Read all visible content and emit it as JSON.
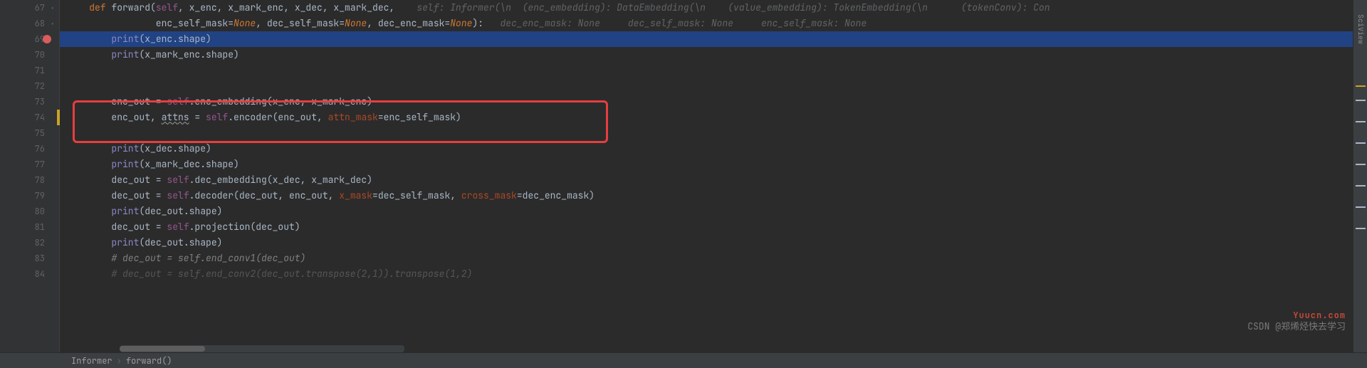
{
  "gutter": {
    "lines": [
      "67",
      "68",
      "69",
      "70",
      "71",
      "72",
      "73",
      "74",
      "75",
      "76",
      "77",
      "78",
      "79",
      "80",
      "81",
      "82",
      "83",
      "84"
    ]
  },
  "code": {
    "l67_def": "def ",
    "l67_name": "forward(",
    "l67_self": "self",
    "l67_rest": ", x_enc, x_mark_enc, x_dec, x_mark_dec,",
    "l67_hint": "    self: Informer(\\n  (enc_embedding): DataEmbedding(\\n    (value_embedding): TokenEmbedding(\\n      (tokenConv): Con",
    "l68_a": "                enc_self_mask=",
    "l68_b": ", dec_self_mask=",
    "l68_c": ", dec_enc_mask=",
    "l68_d": "):",
    "l68_none": "None",
    "l68_hint": "   dec_enc_mask: None     dec_self_mask: None     enc_self_mask: None",
    "l69_print": "print",
    "l69_open": "(x_enc.shape)",
    "l70_print": "print",
    "l70_open": "(x_mark_enc.shape)",
    "l73_a": "enc_out = ",
    "l73_self": "self",
    "l73_b": ".enc_embedding(x_enc, x_mark_enc)",
    "l74_a": "enc_out, ",
    "l74_attns": "attns",
    "l74_b": " = ",
    "l74_self": "self",
    "l74_c": ".encoder(enc_out, ",
    "l74_kw": "attn_mask",
    "l74_d": "=enc_self_mask)",
    "l76_print": "print",
    "l76_open": "(x_dec.shape)",
    "l77_print": "print",
    "l77_open": "(x_mark_dec.shape)",
    "l78_a": "dec_out = ",
    "l78_self": "self",
    "l78_b": ".dec_embedding(x_dec, x_mark_dec)",
    "l79_a": "dec_out = ",
    "l79_self": "self",
    "l79_b": ".decoder(dec_out, enc_out, ",
    "l79_kw1": "x_mask",
    "l79_c": "=dec_self_mask, ",
    "l79_kw2": "cross_mask",
    "l79_d": "=dec_enc_mask)",
    "l80_print": "print",
    "l80_open": "(dec_out.shape)",
    "l81_a": "dec_out = ",
    "l81_self": "self",
    "l81_b": ".projection(dec_out)",
    "l82_print": "print",
    "l82_open": "(dec_out.shape)",
    "l83_comment": "# dec_out = self.end_conv1(dec_out)",
    "l84_comment": "# dec_out = self.end_conv2(dec_out.transpose(2,1)).transpose(1,2)"
  },
  "breadcrumb": {
    "class": "Informer",
    "method": "forward()"
  },
  "sidebar": {
    "label": "SciView"
  },
  "watermark": {
    "site": "Yuucn.com",
    "csdn": "CSDN @郑烯烃快去学习"
  }
}
